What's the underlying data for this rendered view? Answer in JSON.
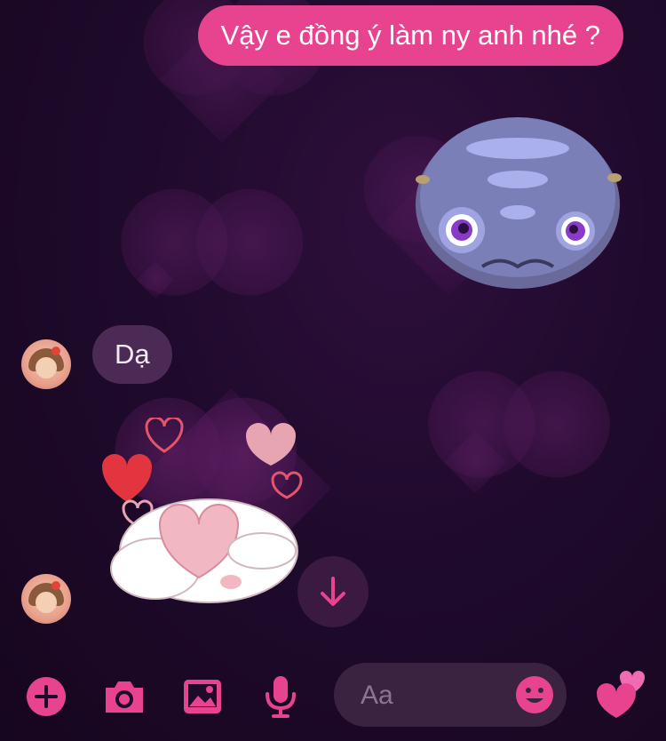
{
  "messages": {
    "outgoing": {
      "text": "Vậy e đồng ý làm ny anh nhé ?"
    },
    "incoming": {
      "text": "Dạ"
    }
  },
  "composer": {
    "placeholder": "Aa"
  },
  "colors": {
    "accent": "#e8438f",
    "background": "#1f0a2c",
    "incoming_bubble": "#4b2a55"
  },
  "icons": {
    "add": "plus-circle-icon",
    "camera": "camera-icon",
    "gallery": "image-icon",
    "mic": "microphone-icon",
    "emoji": "smiley-icon",
    "like": "heart-icon",
    "scroll": "arrow-down-icon"
  }
}
